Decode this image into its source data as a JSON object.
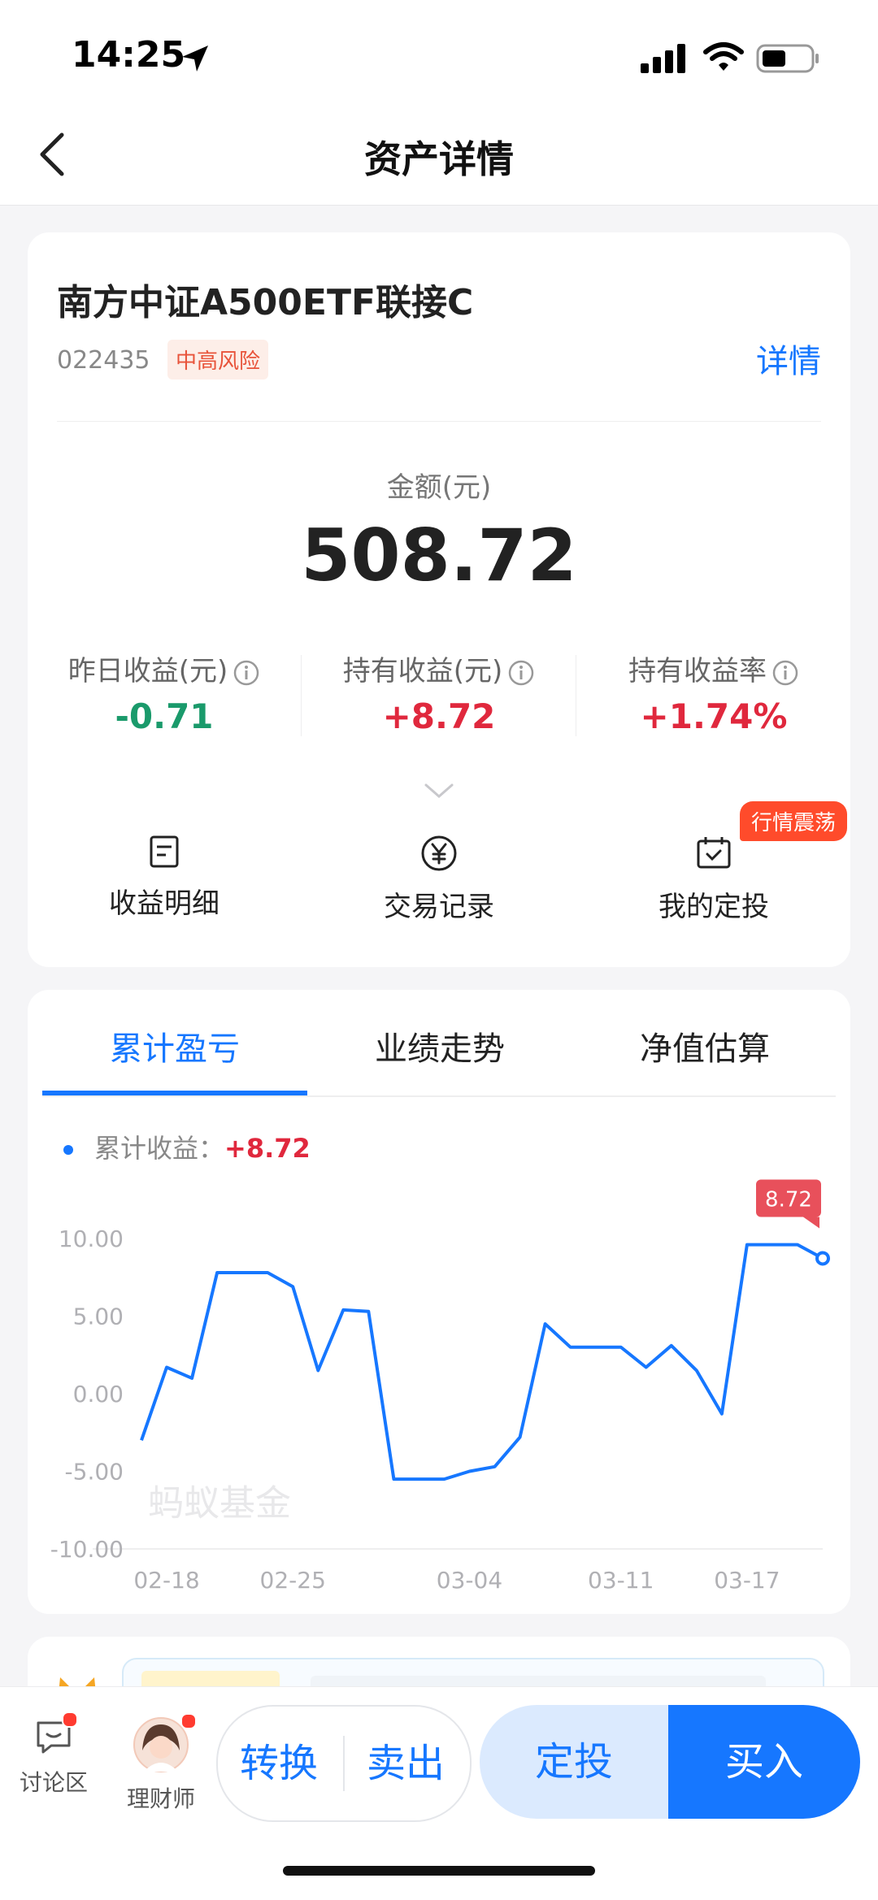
{
  "status": {
    "time": "14:25"
  },
  "nav": {
    "title": "资产详情"
  },
  "fund": {
    "name": "南方中证A500ETF联接C",
    "code": "022435",
    "risk": "中高风险",
    "detail_link": "详情",
    "amount_label": "金额(元)",
    "amount": "508.72",
    "stats": [
      {
        "label": "昨日收益(元)",
        "value": "-0.71",
        "color": "#1a9a6b"
      },
      {
        "label": "持有收益(元)",
        "value": "+8.72",
        "color": "#e0283d"
      },
      {
        "label": "持有收益率",
        "value": "+1.74%",
        "color": "#e0283d"
      }
    ],
    "actions": [
      {
        "label": "收益明细",
        "icon": "doc-icon"
      },
      {
        "label": "交易记录",
        "icon": "yuan-icon"
      },
      {
        "label": "我的定投",
        "icon": "calendar-check-icon"
      }
    ],
    "hot_badge": "行情震荡"
  },
  "chart_tabs": [
    "累计盈亏",
    "业绩走势",
    "净值估算"
  ],
  "legend": {
    "label": "累计收益：",
    "value": "+8.72"
  },
  "watermark": "蚂蚁基金",
  "chart_data": {
    "type": "line",
    "x_ticks": [
      "02-18",
      "02-25",
      "03-04",
      "03-11",
      "03-17"
    ],
    "y_ticks": [
      "10.00",
      "5.00",
      "0.00",
      "-5.00",
      "-10.00"
    ],
    "ylim": [
      -10,
      10
    ],
    "series": [
      {
        "values": [
          -3.0,
          1.7,
          1.0,
          7.8,
          7.8,
          7.8,
          6.9,
          1.5,
          5.4,
          5.3,
          -5.5,
          -5.5,
          -5.5,
          -5.0,
          -4.7,
          -2.8,
          4.5,
          3.0,
          3.0,
          3.0,
          1.7,
          3.1,
          1.5,
          -1.3,
          9.6,
          9.6,
          9.6,
          8.72
        ]
      }
    ],
    "tick_positions": [
      1,
      6,
      13,
      19,
      24
    ],
    "last_label": "8.72",
    "color": "#1677ff"
  },
  "bottom": {
    "discuss": "讨论区",
    "advisor": "理财师",
    "convert": "转换",
    "sell": "卖出",
    "auto_invest": "定投",
    "buy": "买入"
  }
}
